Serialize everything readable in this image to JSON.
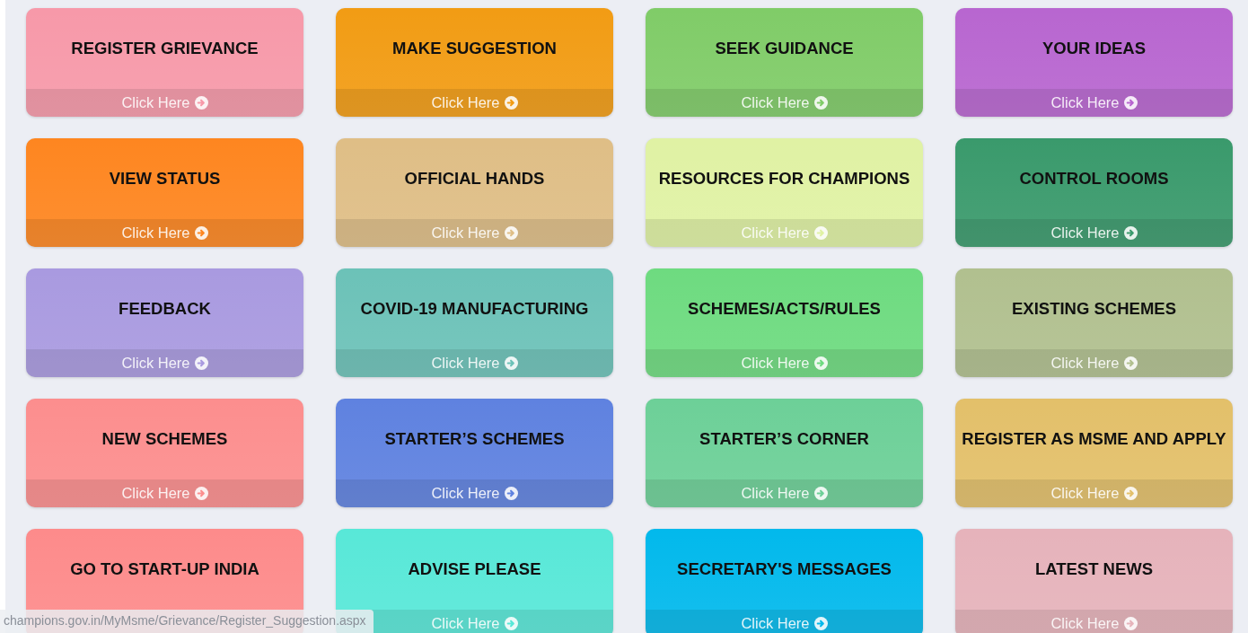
{
  "tiles": [
    {
      "title": "REGISTER GRIEVANCE",
      "link": "Click Here",
      "color": "#f799a9"
    },
    {
      "title": "MAKE SUGGESTION",
      "link": "Click Here",
      "color": "#f29c14"
    },
    {
      "title": "SEEK GUIDANCE",
      "link": "Click Here",
      "color": "#80cc68"
    },
    {
      "title": "YOUR IDEAS",
      "link": "Click Here",
      "color": "#b866d0"
    },
    {
      "title": "VIEW STATUS",
      "link": "Click Here",
      "color": "#fe8620"
    },
    {
      "title": "OFFICIAL HANDS",
      "link": "Click Here",
      "color": "#dfbe86"
    },
    {
      "title": "RESOURCES FOR CHAMPIONS",
      "link": "Click Here",
      "color": "#e0f2a4"
    },
    {
      "title": "CONTROL ROOMS",
      "link": "Click Here",
      "color": "#3a9a6c"
    },
    {
      "title": "FEEDBACK",
      "link": "Click Here",
      "color": "#a99ae0"
    },
    {
      "title": "COVID-19 MANUFACTURING",
      "link": "Click Here",
      "color": "#6cc2b8"
    },
    {
      "title": "SCHEMES/ACTS/RULES",
      "link": "Click Here",
      "color": "#6edb80"
    },
    {
      "title": "EXISTING SCHEMES",
      "link": "Click Here",
      "color": "#b1c08f"
    },
    {
      "title": "NEW SCHEMES",
      "link": "Click Here",
      "color": "#fc8e8e"
    },
    {
      "title": "STARTER’S SCHEMES",
      "link": "Click Here",
      "color": "#5f82e0"
    },
    {
      "title": "STARTER’S CORNER",
      "link": "Click Here",
      "color": "#6dd098"
    },
    {
      "title": "REGISTER AS MSME AND APPLY",
      "link": "Click Here",
      "color": "#e3c06a"
    },
    {
      "title": "GO TO START-UP INDIA",
      "color": "#fd8b8b"
    },
    {
      "title": "ADVISE PLEASE",
      "link": "Click Here",
      "color": "#58e8d8"
    },
    {
      "title": "SECRETARY'S MESSAGES",
      "link": "Click Here",
      "color": "#02b9ec"
    },
    {
      "title": "LATEST NEWS",
      "link": "Click Here",
      "color": "#e6b3bb"
    }
  ],
  "status_bar": {
    "url": "champions.gov.in/MyMsme/Grievance/Register_Suggestion.aspx"
  }
}
